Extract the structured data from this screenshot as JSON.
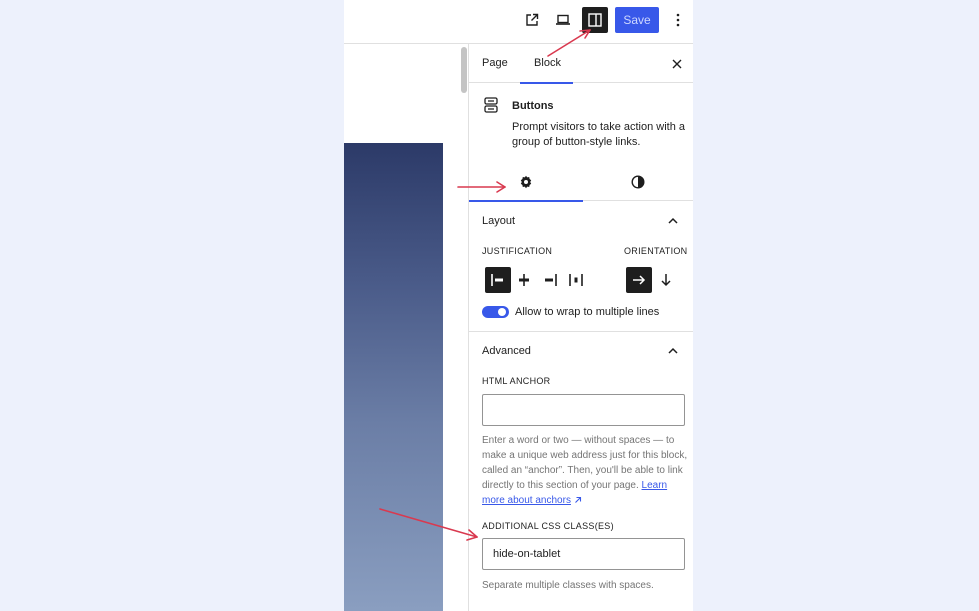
{
  "toolbar": {
    "save_label": "Save"
  },
  "sidebar": {
    "tabs": [
      {
        "label": "Page"
      },
      {
        "label": "Block"
      }
    ],
    "block": {
      "title": "Buttons",
      "description": "Prompt visitors to take action with a group of button-style links."
    },
    "layout": {
      "title": "Layout",
      "justification_label": "JUSTIFICATION",
      "orientation_label": "ORIENTATION",
      "wrap_label": "Allow to wrap to multiple lines",
      "wrap_enabled": true
    },
    "advanced": {
      "title": "Advanced",
      "anchor_label": "HTML ANCHOR",
      "anchor_value": "",
      "anchor_help": "Enter a word or two — without spaces — to make a unique web address just for this block, called an “anchor”. Then, you'll be able to link directly to this section of your page.",
      "anchor_link": "Learn more about anchors",
      "css_label": "ADDITIONAL CSS CLASS(ES)",
      "css_value": "hide-on-tablet",
      "css_help": "Separate multiple classes with spaces."
    }
  },
  "colors": {
    "accent": "#3858e9",
    "annotation_arrow": "#d9394f",
    "background": "#edf1fc"
  }
}
